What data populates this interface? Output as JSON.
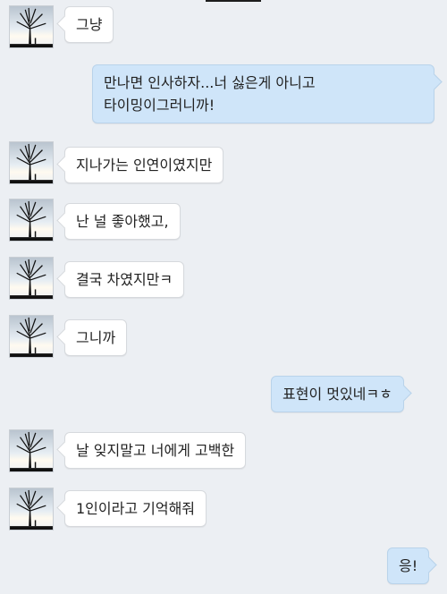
{
  "messages": [
    {
      "side": "left",
      "text": "그냥"
    },
    {
      "side": "right",
      "lines": [
        "만나면 인사하자...너 싫은게 아니고",
        "타이밍이그러니까!"
      ]
    },
    {
      "side": "left",
      "text": "지나가는 인연이였지만"
    },
    {
      "side": "left",
      "text": "난 널 좋아했고,"
    },
    {
      "side": "left",
      "text": "결국 차였지만ㅋ"
    },
    {
      "side": "left",
      "text": "그니까"
    },
    {
      "side": "right",
      "text": "표현이 멋있네ㅋㅎ"
    },
    {
      "side": "left",
      "text": "날 잊지말고 너에게 고백한"
    },
    {
      "side": "left",
      "text": "1인이라고 기억해줘"
    },
    {
      "side": "right",
      "text": "응!"
    }
  ],
  "avatar_icon": "tree-silhouette-avatar",
  "colors": {
    "background": "#eceff3",
    "incoming_bubble": "#ffffff",
    "outgoing_bubble": "#cfe5f9"
  }
}
